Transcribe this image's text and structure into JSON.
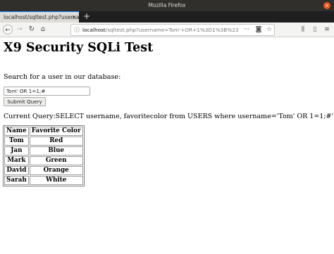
{
  "window": {
    "title": "Mozilla Firefox",
    "close_glyph": "×"
  },
  "tab": {
    "label": "localhost/sqltest.php?userna",
    "close_glyph": "×"
  },
  "new_tab_glyph": "+",
  "nav": {
    "back_icon": "←",
    "forward_icon": "→",
    "reload_icon": "↻",
    "home_icon": "⌂"
  },
  "url": {
    "info_icon": "ⓘ",
    "host": "localhost",
    "path": "/sqltest.php?username=Tom'+OR+1%3D1%3B%23",
    "more_icon": "···",
    "pocket_icon": "◙",
    "bookmark_icon": "☆"
  },
  "toolbar": {
    "library_icon": "⫼",
    "sidebar_icon": "▯",
    "menu_icon": "≡"
  },
  "page": {
    "title": "X9 Security SQLi Test",
    "prompt": "Search for a user in our database:",
    "search_value": "Tom' OR 1=1;#",
    "submit_label": "Submit Query",
    "query_line": "Current Query:SELECT username, favoritecolor from USERS where username='Tom' OR 1=1;#'"
  },
  "table": {
    "headers": [
      "Name",
      "Favorite Color"
    ],
    "rows": [
      [
        "Tom",
        "Red"
      ],
      [
        "Jan",
        "Blue"
      ],
      [
        "Mark",
        "Green"
      ],
      [
        "David",
        "Orange"
      ],
      [
        "Sarah",
        "White"
      ]
    ]
  }
}
